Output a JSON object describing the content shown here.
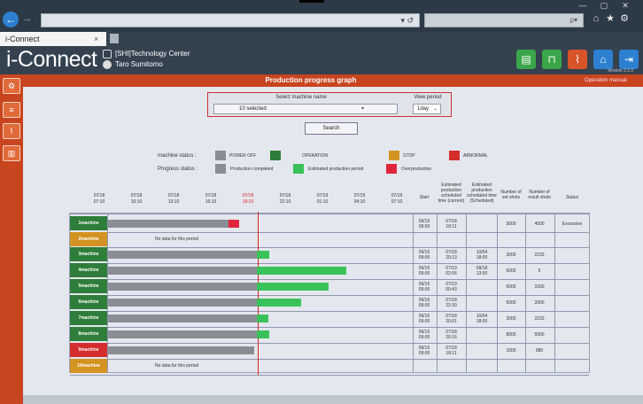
{
  "browser": {
    "back": "←",
    "forward": "→",
    "search_glyphs": "ρ▾",
    "tab_title": "i-Connect",
    "tab_close": "×",
    "icons": [
      "⌂",
      "★",
      "⚙"
    ],
    "window": [
      "—",
      "▢",
      "✕"
    ],
    "refresh": "▾ ↺"
  },
  "header": {
    "brand": "i-Connect",
    "org": "[SHI]Technology Center",
    "user": "Taro Sumitomo",
    "version": "Version 2.1.0"
  },
  "page": {
    "title": "Production progress graph",
    "manual": "Operation manual"
  },
  "filters": {
    "machine_label": "Select machine name",
    "machine_value": "10 selected",
    "period_label": "View period",
    "period_value": "1day",
    "search": "Search"
  },
  "legend": {
    "machine_status_label": "machine status :",
    "progress_status_label": "Progress status :",
    "machine": [
      {
        "text": "POWER OFF",
        "color": "#8a8d93"
      },
      {
        "text": "OPERATION",
        "color": "#2f7d3a"
      },
      {
        "text": "STOP",
        "color": "#d39322"
      },
      {
        "text": "ABNORMAL",
        "color": "#d42d2d"
      }
    ],
    "progress": [
      {
        "text": "Production completed",
        "color": "#8a8d93"
      },
      {
        "text": "Estimated production period",
        "color": "#39c25a"
      },
      {
        "text": "Overproduction",
        "color": "#e0263d"
      }
    ]
  },
  "timeline": [
    "07/18\n07:10",
    "07/18\n10:10",
    "07/18\n13:10",
    "07/18\n16:10",
    "07/18\n19:10",
    "07/18\n22:10",
    "07/19\n01:10",
    "07/19\n04:10",
    "07/19\n07:10"
  ],
  "columns": [
    "Start",
    "Estimated production scheduled time (current)",
    "Estimated production scheduled time (Scheduled)",
    "Number of set shots",
    "Number of result shots",
    "Status"
  ],
  "nodata": "No data for this period",
  "rows": [
    {
      "name": "1machine",
      "color": "#2f7d3a",
      "start": "09/15\n09:00",
      "cur": "07/18\n18:11",
      "sch": "",
      "set": "3000",
      "res": "4000",
      "status": "Excessive",
      "gray": 0.87,
      "green": 0,
      "red": 0.05
    },
    {
      "name": "2machine",
      "color": "#d39322",
      "nodata": true
    },
    {
      "name": "3machine",
      "color": "#2f7d3a",
      "start": "09/15\n09:00",
      "cur": "07/18\n20:13",
      "sch": "10/04\n18:00",
      "set": "3000",
      "res": "2233",
      "status": "",
      "gray": 0.99,
      "green": 0.08,
      "red": 0
    },
    {
      "name": "4machine",
      "color": "#2f7d3a",
      "start": "09/15\n09:00",
      "cur": "07/19\n02:06",
      "sch": "09/18\n13:50",
      "set": "5000",
      "res": "5",
      "status": "",
      "gray": 0.99,
      "green": 0.56,
      "red": 0
    },
    {
      "name": "5machine",
      "color": "#2f7d3a",
      "start": "09/15\n09:00",
      "cur": "07/19\n00:43",
      "sch": "",
      "set": "5000",
      "res": "1000",
      "status": "",
      "gray": 0.99,
      "green": 0.45,
      "red": 0
    },
    {
      "name": "6machine",
      "color": "#2f7d3a",
      "start": "09/15\n09:00",
      "cur": "07/18\n22:30",
      "sch": "",
      "set": "5000",
      "res": "2000",
      "status": "",
      "gray": 0.99,
      "green": 0.28,
      "red": 0
    },
    {
      "name": "7machine",
      "color": "#2f7d3a",
      "start": "09/15\n09:00",
      "cur": "07/18\n20:01",
      "sch": "10/04\n18:00",
      "set": "3000",
      "res": "2233",
      "status": "",
      "gray": 0.99,
      "green": 0.07,
      "red": 0
    },
    {
      "name": "8machine",
      "color": "#2f7d3a",
      "start": "09/15\n09:00",
      "cur": "07/18\n20:16",
      "sch": "",
      "set": "8000",
      "res": "5000",
      "status": "",
      "gray": 0.99,
      "green": 0.08,
      "red": 0
    },
    {
      "name": "9machine",
      "color": "#d42d2d",
      "start": "09/15\n09:00",
      "cur": "07/18\n18:11",
      "sch": "",
      "set": "1000",
      "res": "980",
      "status": "",
      "gray": 0.97,
      "green": 0,
      "red": 0
    },
    {
      "name": "10machine",
      "color": "#d39322",
      "nodata": true
    }
  ]
}
